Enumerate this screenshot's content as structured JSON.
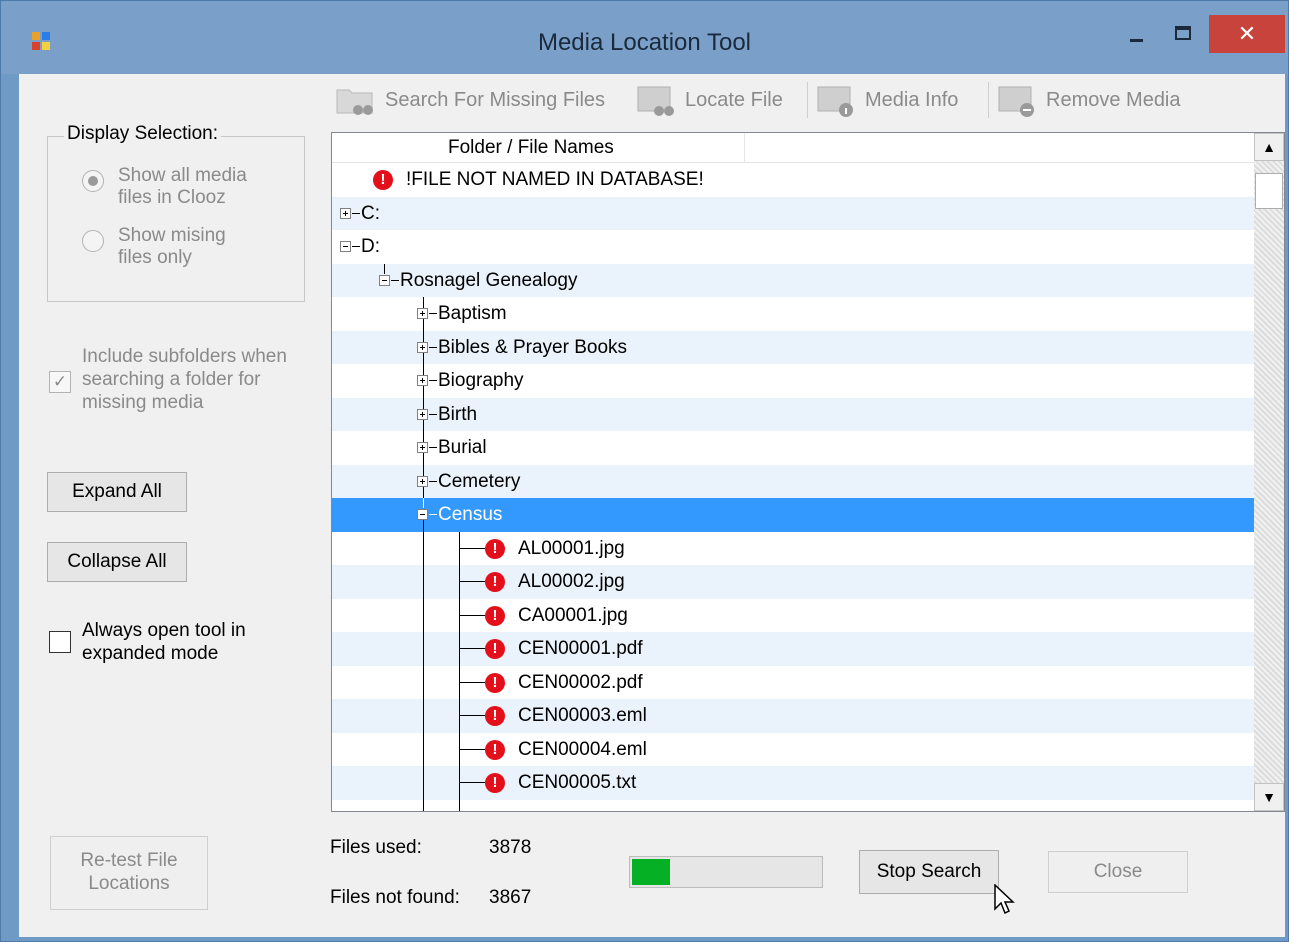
{
  "window": {
    "title": "Media Location Tool",
    "close_glyph": "✕"
  },
  "display_selection": {
    "legend": "Display Selection:",
    "options": [
      {
        "label": "Show all media\nfiles in Clooz",
        "selected": true
      },
      {
        "label": "Show mising\nfiles only",
        "selected": false
      }
    ]
  },
  "include_subfolders": {
    "label": "Include subfolders when\nsearching a folder for\nmissing media",
    "checked": true,
    "check_glyph": "✓"
  },
  "buttons": {
    "expand_all": "Expand All",
    "collapse_all": "Collapse All",
    "retest": "Re-test File\nLocations",
    "stop_search": "Stop Search",
    "close": "Close"
  },
  "always_open": {
    "label": "Always open tool in\nexpanded mode",
    "checked": false
  },
  "toolbar": {
    "search_missing": "Search For Missing Files",
    "locate_file": "Locate File",
    "media_info": "Media Info",
    "remove_media": "Remove Media"
  },
  "tree": {
    "column_header": "Folder / File Names",
    "error_glyph": "!",
    "rows": [
      {
        "label": "!FILE NOT NAMED IN DATABASE!",
        "type": "error-root"
      },
      {
        "label": "C:",
        "type": "drive",
        "expander": "plus"
      },
      {
        "label": "D:",
        "type": "drive",
        "expander": "minus"
      },
      {
        "label": "Rosnagel Genealogy",
        "type": "folder-l1",
        "expander": "minus"
      },
      {
        "label": "Baptism",
        "type": "folder-l2",
        "expander": "plus"
      },
      {
        "label": "Bibles & Prayer Books",
        "type": "folder-l2",
        "expander": "plus"
      },
      {
        "label": "Biography",
        "type": "folder-l2",
        "expander": "plus"
      },
      {
        "label": "Birth",
        "type": "folder-l2",
        "expander": "plus"
      },
      {
        "label": "Burial",
        "type": "folder-l2",
        "expander": "plus"
      },
      {
        "label": "Cemetery",
        "type": "folder-l2",
        "expander": "plus"
      },
      {
        "label": "Census",
        "type": "folder-l2",
        "expander": "minus",
        "selected": true
      },
      {
        "label": "AL00001.jpg",
        "type": "file"
      },
      {
        "label": "AL00002.jpg",
        "type": "file"
      },
      {
        "label": "CA00001.jpg",
        "type": "file"
      },
      {
        "label": "CEN00001.pdf",
        "type": "file"
      },
      {
        "label": "CEN00002.pdf",
        "type": "file"
      },
      {
        "label": "CEN00003.eml",
        "type": "file"
      },
      {
        "label": "CEN00004.eml",
        "type": "file"
      },
      {
        "label": "CEN00005.txt",
        "type": "file"
      }
    ]
  },
  "scrollbar": {
    "up_glyph": "▲",
    "down_glyph": "▼"
  },
  "stats": {
    "files_used_label": "Files used:",
    "files_used_value": "3878",
    "files_not_found_label": "Files not found:",
    "files_not_found_value": "3867"
  },
  "progress": {
    "fraction": 0.2,
    "color": "#06b025"
  }
}
